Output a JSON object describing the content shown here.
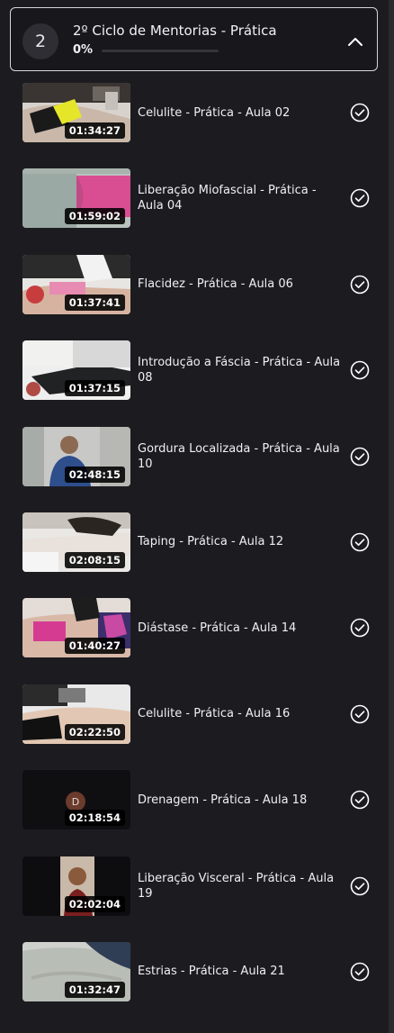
{
  "module": {
    "number": "2",
    "title": "2º Ciclo de Mentorias - Prática",
    "progress_label": "0%",
    "progress": 0
  },
  "lessons": [
    {
      "title": "Celulite - Prática - Aula 02",
      "duration": "01:34:27",
      "thumb": "thumb-1"
    },
    {
      "title": "Liberação Miofascial - Prática - Aula 04",
      "duration": "01:59:02",
      "thumb": "thumb-2"
    },
    {
      "title": "Flacidez - Prática - Aula 06",
      "duration": "01:37:41",
      "thumb": "thumb-3"
    },
    {
      "title": "Introdução a Fáscia - Prática - Aula 08",
      "duration": "01:37:15",
      "thumb": "thumb-4"
    },
    {
      "title": "Gordura Localizada - Prática - Aula 10",
      "duration": "02:48:15",
      "thumb": "thumb-5"
    },
    {
      "title": "Taping - Prática - Aula 12",
      "duration": "02:08:15",
      "thumb": "thumb-6"
    },
    {
      "title": "Diástase - Prática - Aula 14",
      "duration": "01:40:27",
      "thumb": "thumb-7"
    },
    {
      "title": "Celulite - Prática - Aula 16",
      "duration": "02:22:50",
      "thumb": "thumb-8"
    },
    {
      "title": "Drenagem - Prática - Aula 18",
      "duration": "02:18:54",
      "thumb": "thumb-9",
      "avatar_letter": "D"
    },
    {
      "title": "Liberação Visceral - Prática - Aula 19",
      "duration": "02:02:04",
      "thumb": "thumb-10"
    },
    {
      "title": "Estrias - Prática - Aula 21",
      "duration": "01:32:47",
      "thumb": "thumb-11"
    }
  ],
  "icons": {
    "collapse": "chevron-up-icon",
    "completed": "check-circle-icon"
  },
  "colors": {
    "background": "#1c1c20",
    "text": "#ececf0",
    "progress_accent": "#3b82f6"
  }
}
